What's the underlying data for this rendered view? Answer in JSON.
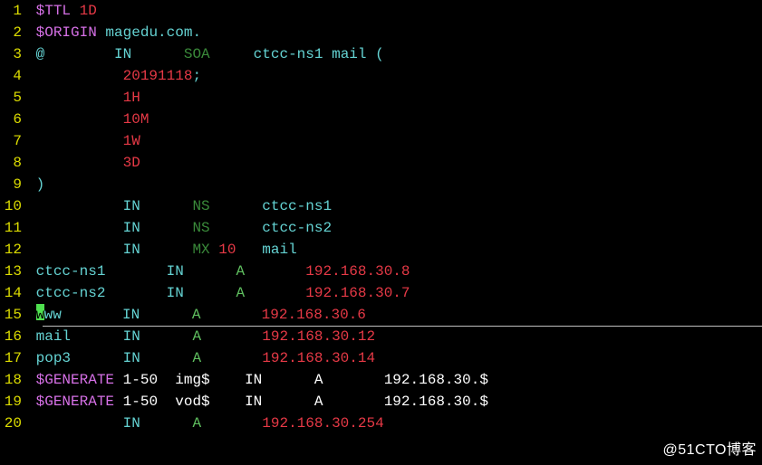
{
  "lines": {
    "l1": {
      "n": "1",
      "p1": "$TTL",
      "p2": " 1D"
    },
    "l2": {
      "n": "2",
      "p1": "$ORIGIN",
      "p2": " magedu.com."
    },
    "l3": {
      "n": "3",
      "p1": "@",
      "p2": "IN",
      "p3": "SOA",
      "p4": "ctcc-ns1 mail ("
    },
    "l4": {
      "n": "4",
      "p1": "20191118",
      "p2": ";"
    },
    "l5": {
      "n": "5",
      "p1": "1H"
    },
    "l6": {
      "n": "6",
      "p1": "10M"
    },
    "l7": {
      "n": "7",
      "p1": "1W"
    },
    "l8": {
      "n": "8",
      "p1": "3D"
    },
    "l9": {
      "n": "9",
      "p1": ")"
    },
    "l10": {
      "n": "10",
      "p1": "IN",
      "p2": "NS",
      "p3": "ctcc-ns1"
    },
    "l11": {
      "n": "11",
      "p1": "IN",
      "p2": "NS",
      "p3": "ctcc-ns2"
    },
    "l12": {
      "n": "12",
      "p1": "IN",
      "p2": "MX ",
      "p3": "10",
      "p4": "mail"
    },
    "l13": {
      "n": "13",
      "p1": "ctcc-ns1",
      "p2": "IN",
      "p3": "A",
      "p4": "192.168.30.8"
    },
    "l14": {
      "n": "14",
      "p1": "ctcc-ns2",
      "p2": "IN",
      "p3": "A",
      "p4": "192.168.30.7"
    },
    "l15": {
      "n": "15",
      "p1": "ww",
      "p2": "IN",
      "p3": "A",
      "p4": "192.168.30.6"
    },
    "l16": {
      "n": "16",
      "p1": "mail",
      "p2": "IN",
      "p3": "A",
      "p4": "192.168.30.12"
    },
    "l17": {
      "n": "17",
      "p1": "pop3",
      "p2": "IN",
      "p3": "A",
      "p4": "192.168.30.14"
    },
    "l18": {
      "n": "18",
      "p1": "$GENERATE",
      "p2": " 1-50",
      "p3": "img$",
      "p4": "IN",
      "p5": "A",
      "p6": "192.168.30.$"
    },
    "l19": {
      "n": "19",
      "p1": "$GENERATE",
      "p2": " 1-50",
      "p3": "vod$",
      "p4": "IN",
      "p5": "A",
      "p6": "192.168.30.$"
    },
    "l20": {
      "n": "20",
      "p1": "IN",
      "p2": "A",
      "p3": "192.168.30.254"
    }
  },
  "watermark": "@51CTO博客"
}
